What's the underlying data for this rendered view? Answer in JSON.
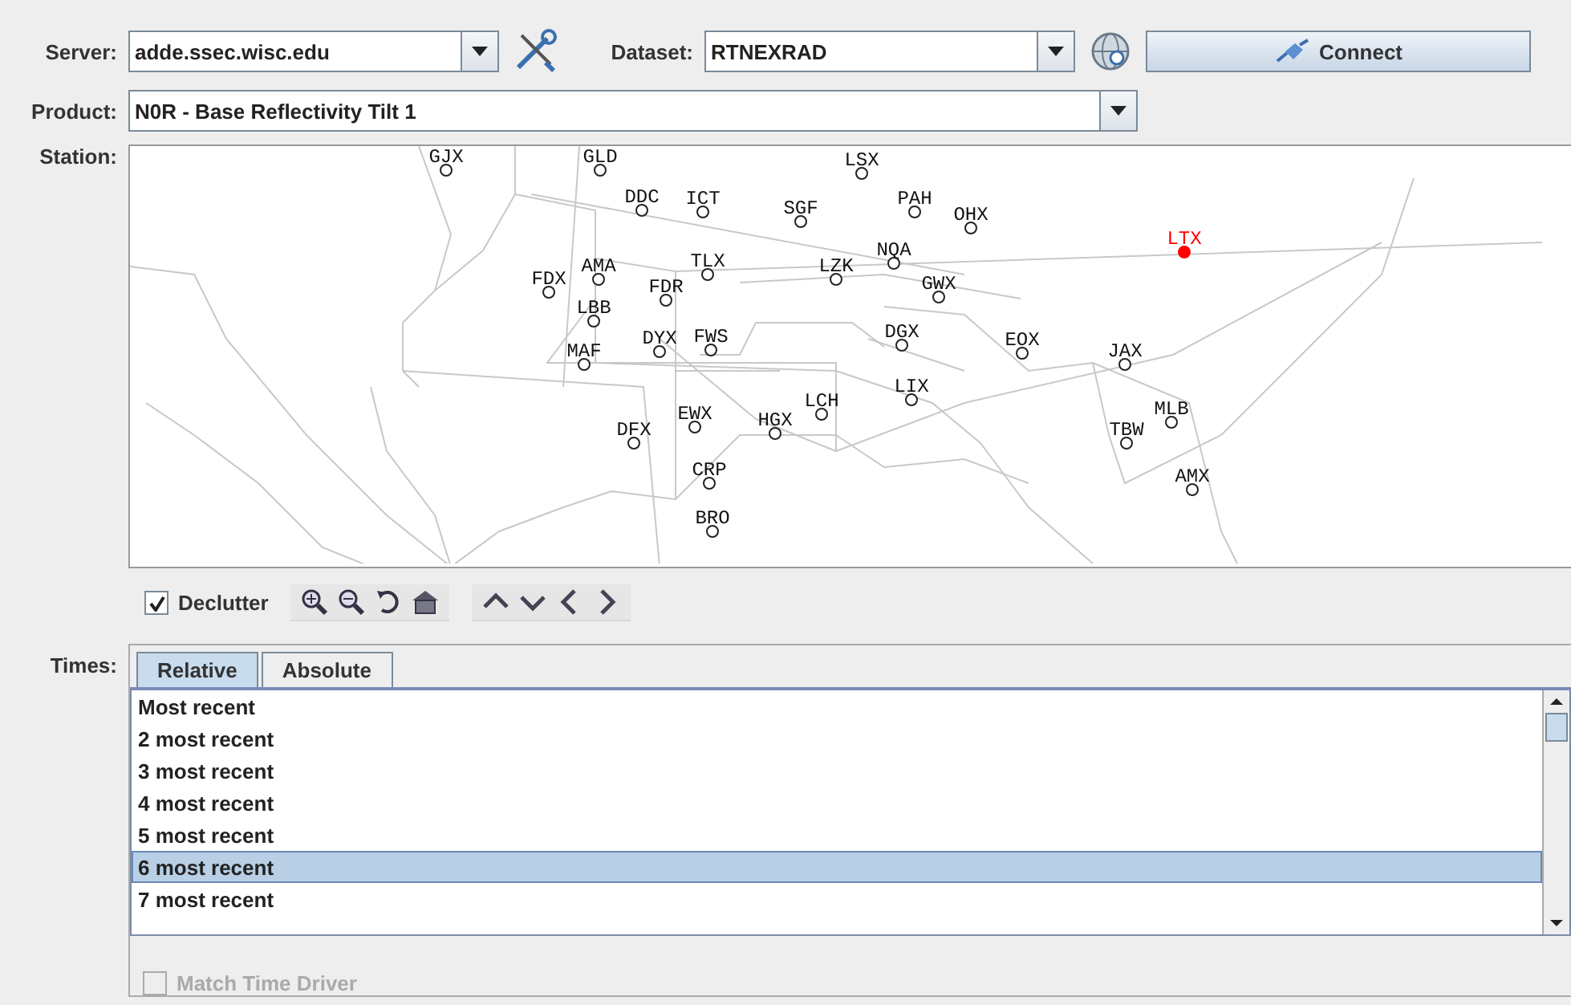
{
  "server": {
    "label": "Server:",
    "value": "adde.ssec.wisc.edu"
  },
  "dataset": {
    "label": "Dataset:",
    "value": "RTNEXRAD"
  },
  "connect_button": "Connect",
  "product": {
    "label": "Product:",
    "value": "N0R - Base Reflectivity Tilt 1"
  },
  "station": {
    "label": "Station:",
    "stations": [
      {
        "code": "GJX",
        "selected": false
      },
      {
        "code": "GLD",
        "selected": false
      },
      {
        "code": "LSX",
        "selected": false
      },
      {
        "code": "DDC",
        "selected": false
      },
      {
        "code": "ICT",
        "selected": false
      },
      {
        "code": "SGF",
        "selected": false
      },
      {
        "code": "PAH",
        "selected": false
      },
      {
        "code": "OHX",
        "selected": false
      },
      {
        "code": "LTX",
        "selected": true
      },
      {
        "code": "NQA",
        "selected": false
      },
      {
        "code": "AMA",
        "selected": false
      },
      {
        "code": "TLX",
        "selected": false
      },
      {
        "code": "LZK",
        "selected": false
      },
      {
        "code": "FDX",
        "selected": false
      },
      {
        "code": "FDR",
        "selected": false
      },
      {
        "code": "GWX",
        "selected": false
      },
      {
        "code": "LBB",
        "selected": false
      },
      {
        "code": "MAF",
        "selected": false
      },
      {
        "code": "DYX",
        "selected": false
      },
      {
        "code": "FWS",
        "selected": false
      },
      {
        "code": "DGX",
        "selected": false
      },
      {
        "code": "EOX",
        "selected": false
      },
      {
        "code": "JAX",
        "selected": false
      },
      {
        "code": "LIX",
        "selected": false
      },
      {
        "code": "LCH",
        "selected": false
      },
      {
        "code": "DFX",
        "selected": false
      },
      {
        "code": "EWX",
        "selected": false
      },
      {
        "code": "HGX",
        "selected": false
      },
      {
        "code": "TBW",
        "selected": false
      },
      {
        "code": "MLB",
        "selected": false
      },
      {
        "code": "CRP",
        "selected": false
      },
      {
        "code": "AMX",
        "selected": false
      },
      {
        "code": "BRO",
        "selected": false
      }
    ]
  },
  "declutter": {
    "label": "Declutter",
    "checked": true
  },
  "times": {
    "label": "Times:",
    "tabs": [
      {
        "label": "Relative",
        "selected": true
      },
      {
        "label": "Absolute",
        "selected": false
      }
    ],
    "items": [
      {
        "text": "Most recent",
        "selected": false
      },
      {
        "text": "2 most recent",
        "selected": false
      },
      {
        "text": "3 most recent",
        "selected": false
      },
      {
        "text": "4 most recent",
        "selected": false
      },
      {
        "text": "5 most recent",
        "selected": false
      },
      {
        "text": "6 most recent",
        "selected": true
      },
      {
        "text": "7 most recent",
        "selected": false
      }
    ],
    "match_time_driver": {
      "label": "Match Time Driver",
      "checked": false,
      "disabled": true
    }
  }
}
